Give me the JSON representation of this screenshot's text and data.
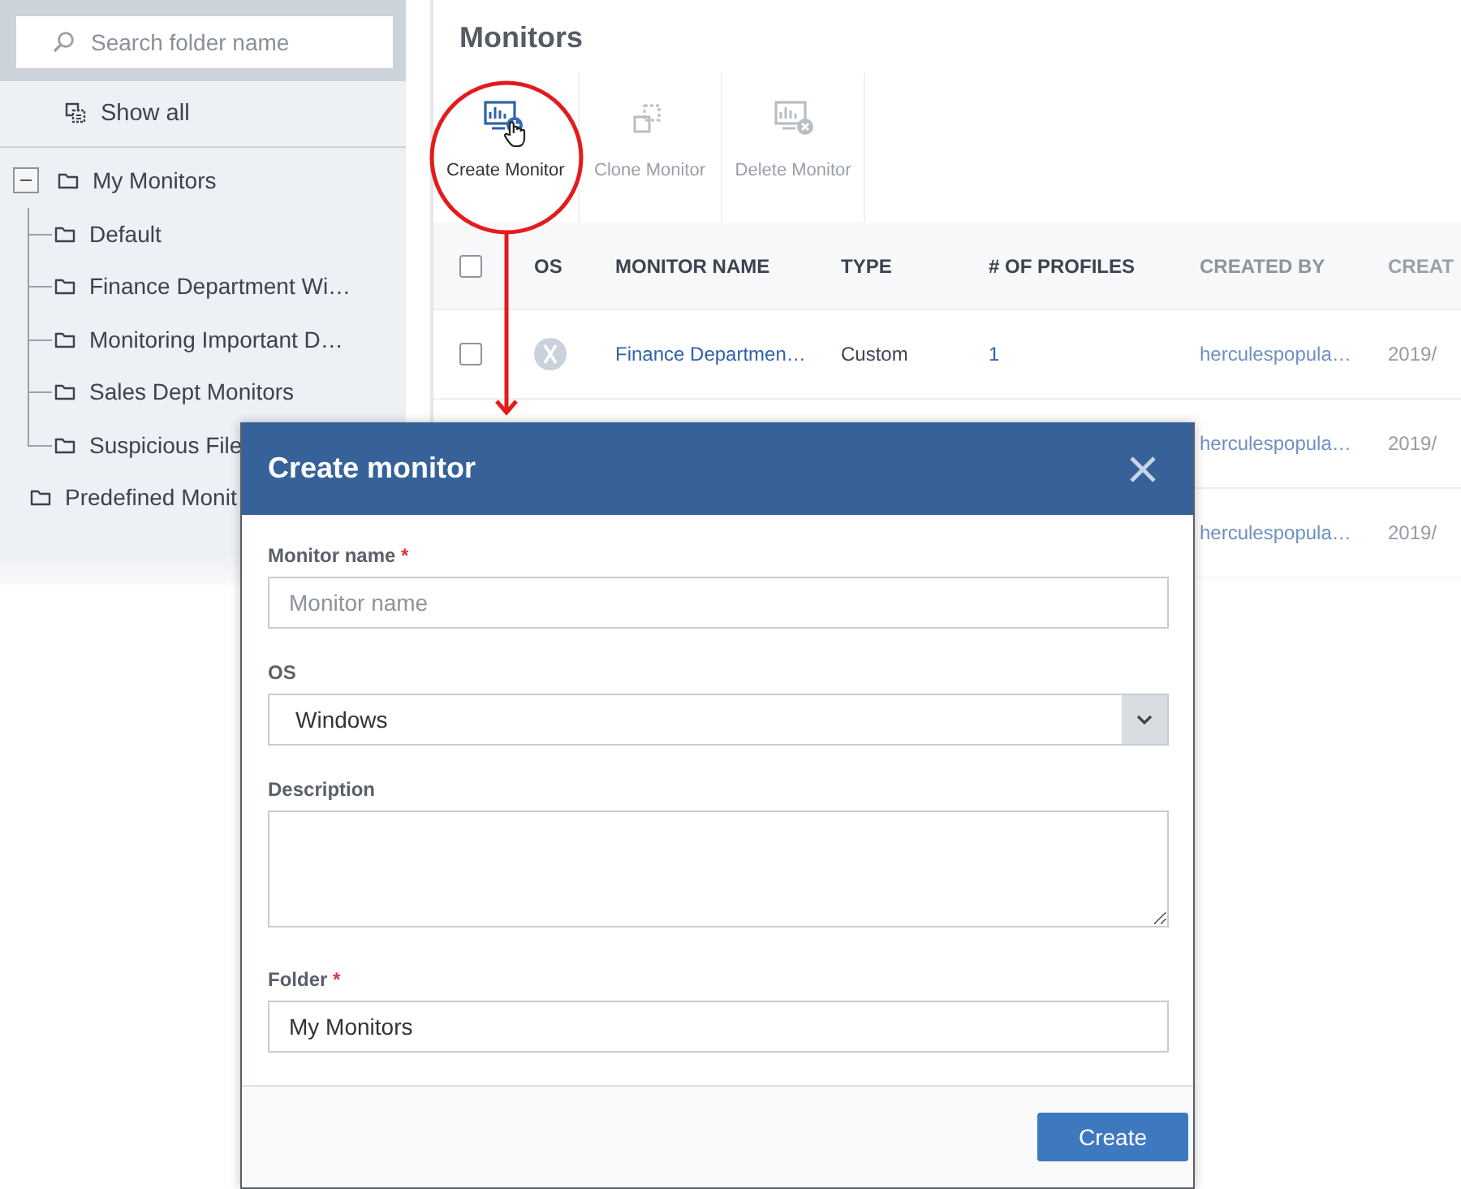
{
  "sidebar": {
    "search": {
      "placeholder": "Search folder name"
    },
    "show_all": "Show all",
    "tree": [
      {
        "label": "My Monitors",
        "expanded": true,
        "children": [
          {
            "label": "Default"
          },
          {
            "label": "Finance Department Wi…"
          },
          {
            "label": "Monitoring Important D…"
          },
          {
            "label": "Sales Dept Monitors"
          },
          {
            "label": "Suspicious File"
          }
        ]
      },
      {
        "label": "Predefined Monit"
      }
    ]
  },
  "main": {
    "title": "Monitors",
    "toolbar": [
      {
        "kind": "create",
        "label": "Create Monitor",
        "disabled": false
      },
      {
        "kind": "clone",
        "label": "Clone Monitor",
        "disabled": true
      },
      {
        "kind": "delete",
        "label": "Delete Monitor",
        "disabled": true
      }
    ],
    "table": {
      "select_all_checked": false,
      "columns": [
        "OS",
        "MONITOR NAME",
        "TYPE",
        "# OF PROFILES",
        "CREATED BY",
        "CREAT"
      ],
      "rows": [
        {
          "checked": false,
          "monitor_name": "Finance Departmen…",
          "type": "Custom",
          "profiles": "1",
          "created_by": "herculespopula…",
          "created": "2019/"
        },
        {
          "created_by": "herculespopula…",
          "created": "2019/"
        },
        {
          "created_by": "herculespopula…",
          "created": "2019/"
        }
      ]
    }
  },
  "dialog": {
    "title": "Create monitor",
    "fields": [
      {
        "kind": "text",
        "label": "Monitor name",
        "required_mark": "*",
        "placeholder": "Monitor name"
      },
      {
        "kind": "select",
        "label": "OS",
        "value": "Windows"
      },
      {
        "kind": "textarea",
        "label": "Description"
      },
      {
        "kind": "text",
        "label": "Folder",
        "required_mark": "*",
        "value": "My Monitors"
      }
    ],
    "buttons": [
      {
        "label": "Create"
      }
    ]
  }
}
